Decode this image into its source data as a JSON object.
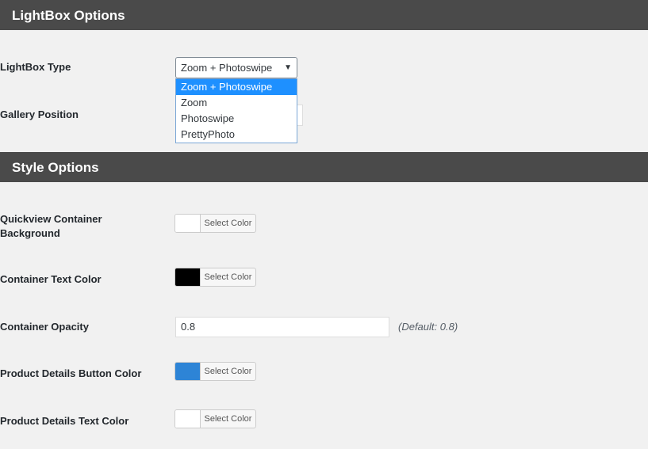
{
  "sections": {
    "lightbox": {
      "title": "LightBox Options"
    },
    "style": {
      "title": "Style Options"
    }
  },
  "lightbox_type": {
    "label": "LightBox Type",
    "selected": "Zoom + Photoswipe",
    "options": [
      "Zoom + Photoswipe",
      "Zoom",
      "Photoswipe",
      "PrettyPhoto"
    ]
  },
  "gallery_position": {
    "label": "Gallery Position"
  },
  "quickview_bg": {
    "label": "Quickview Container Background",
    "button": "Select Color",
    "color": "#ffffff"
  },
  "container_text_color": {
    "label": "Container Text Color",
    "button": "Select Color",
    "color": "#000000"
  },
  "container_opacity": {
    "label": "Container Opacity",
    "value": "0.8",
    "hint": "(Default: 0.8)"
  },
  "product_details_button_color": {
    "label": "Product Details Button Color",
    "button": "Select Color",
    "color": "#2d84d6"
  },
  "product_details_text_color": {
    "label": "Product Details Text Color",
    "button": "Select Color",
    "color": "#ffffff"
  }
}
